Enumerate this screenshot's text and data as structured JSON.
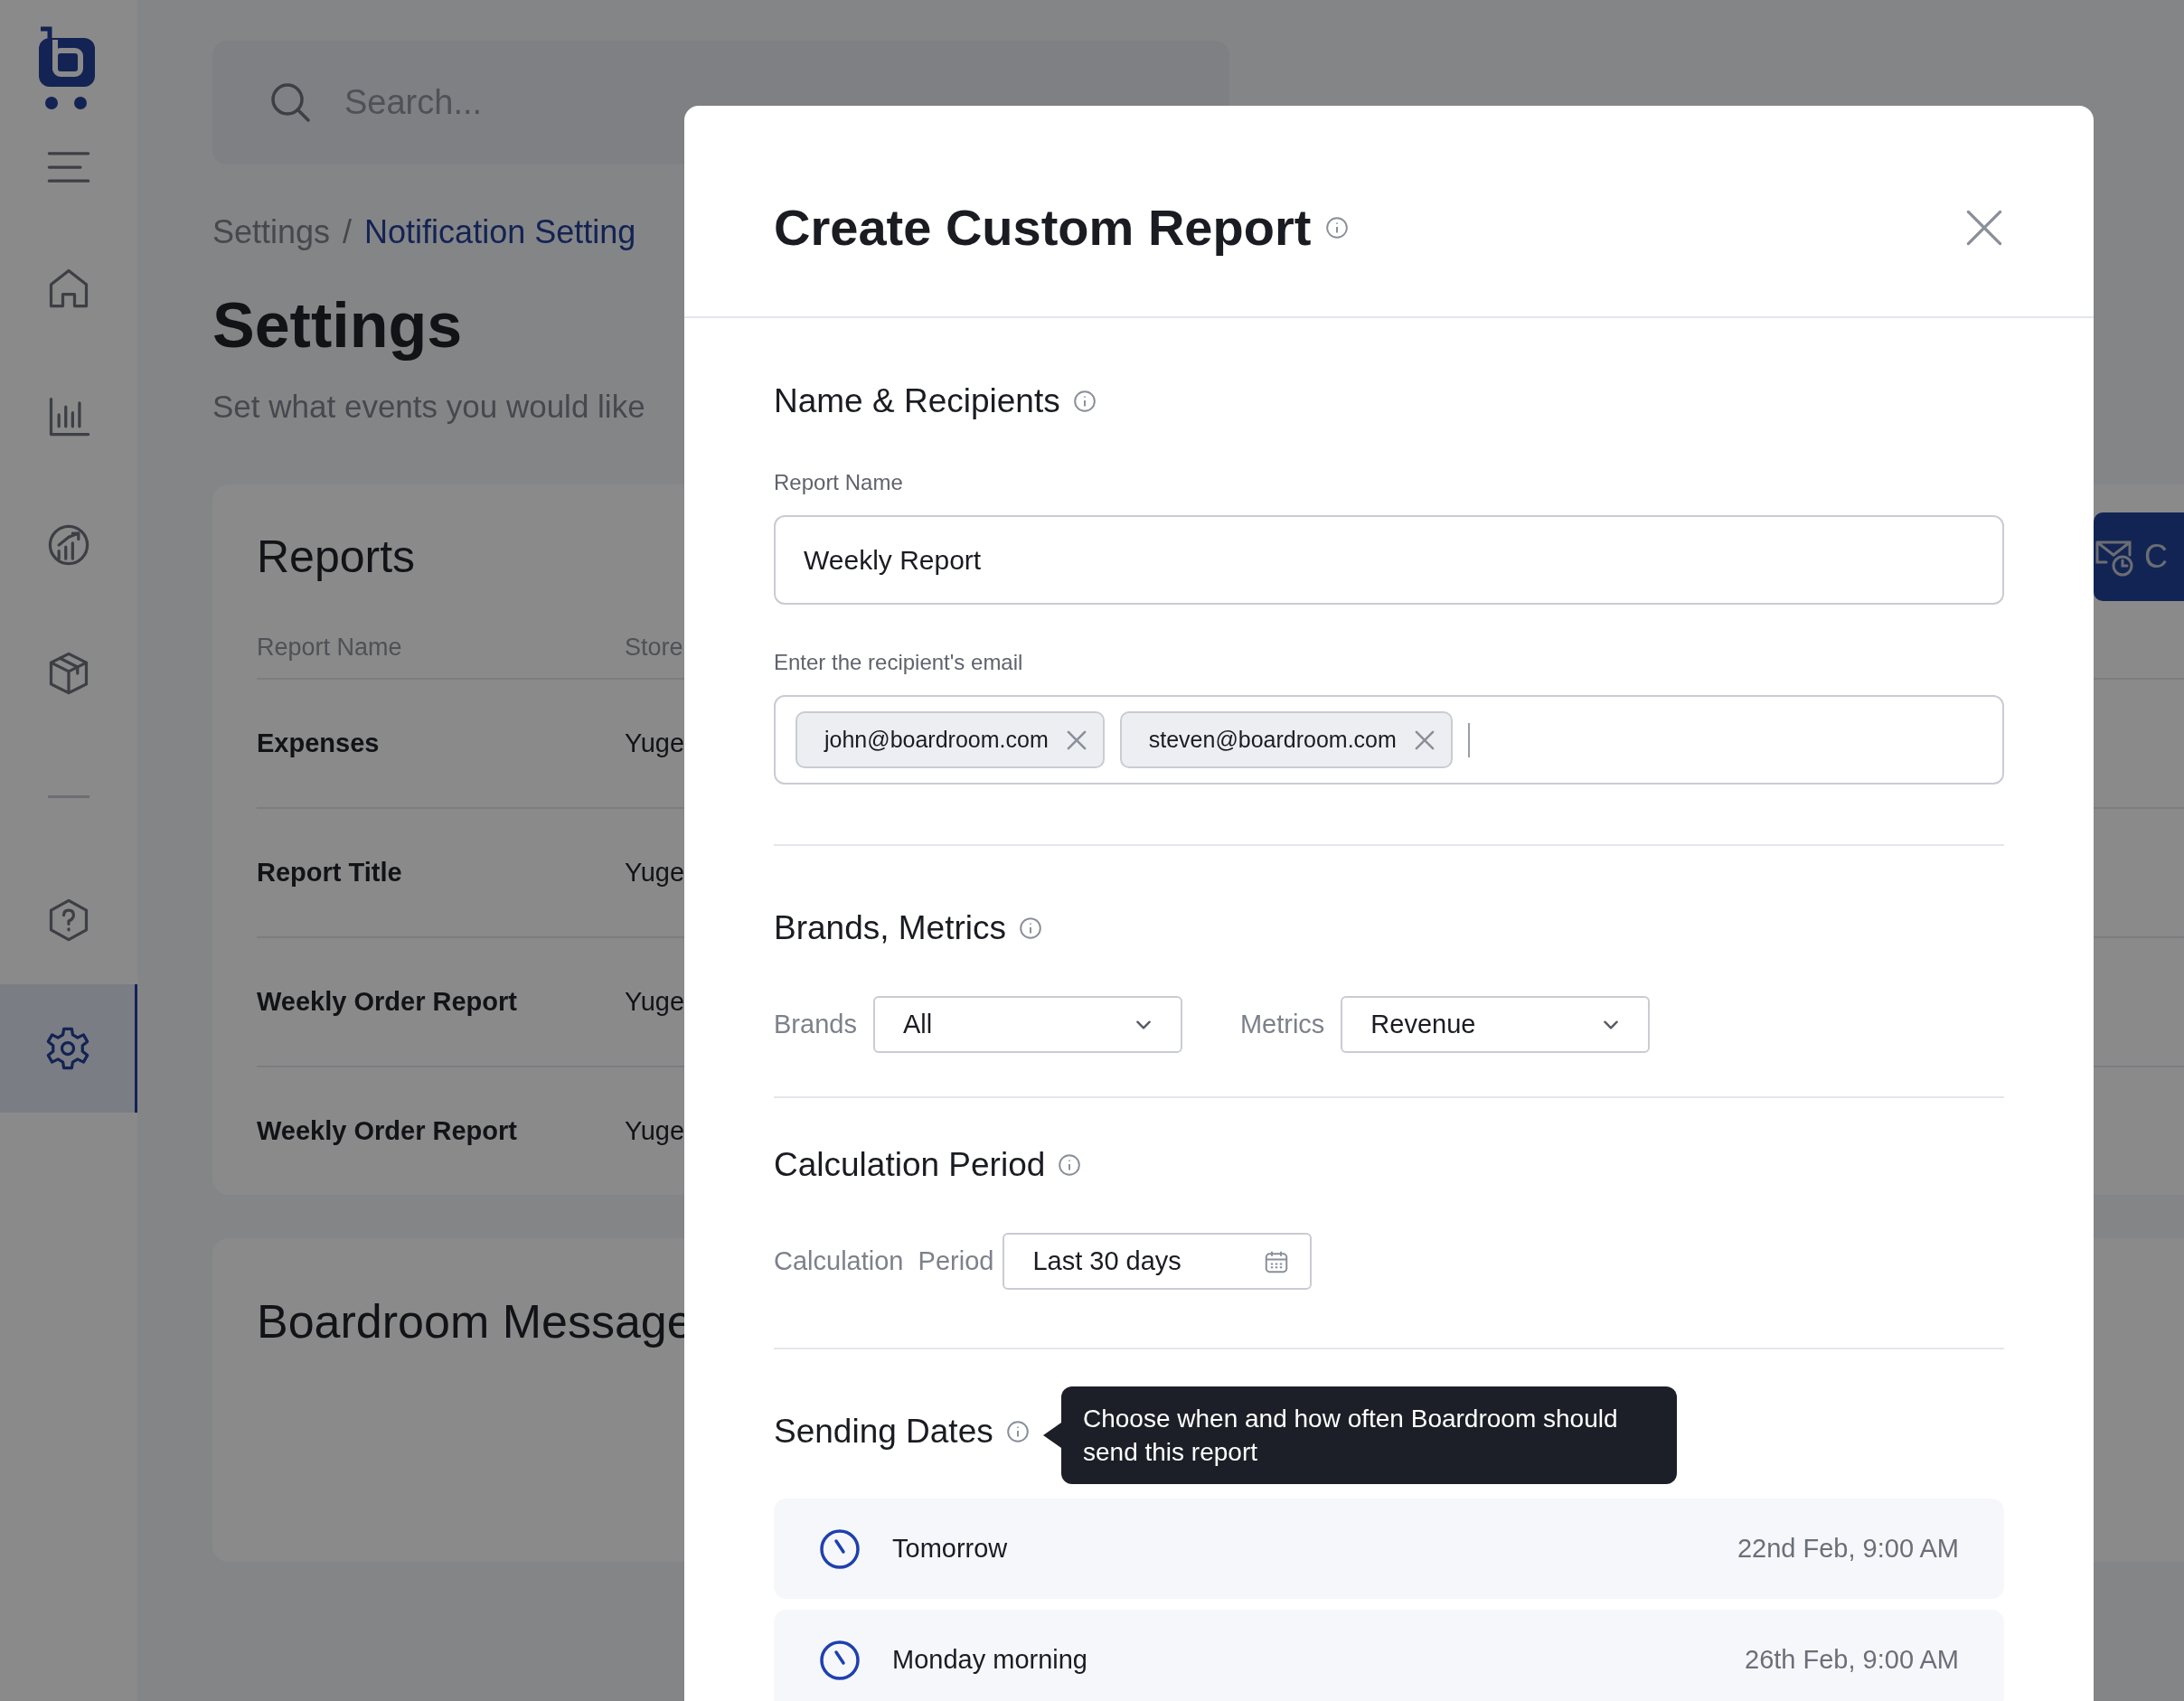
{
  "sidebar": {
    "items": [
      {
        "kind": "menu",
        "selected": false
      },
      {
        "kind": "home",
        "selected": false
      },
      {
        "kind": "chart",
        "selected": false
      },
      {
        "kind": "growth",
        "selected": false
      },
      {
        "kind": "box",
        "selected": false
      },
      {
        "kind": "divider"
      },
      {
        "kind": "help",
        "selected": false
      },
      {
        "kind": "settings",
        "selected": true
      }
    ]
  },
  "search": {
    "placeholder": "Search..."
  },
  "breadcrumb": {
    "separator": "/",
    "items": [
      {
        "label": "Settings",
        "current": false
      },
      {
        "label": "Notification Setting",
        "current": true
      }
    ]
  },
  "page": {
    "title": "Settings",
    "subtitle": "Set what events you would like"
  },
  "reports": {
    "title": "Reports",
    "action_label": "C",
    "columns": [
      "Report Name",
      "Store"
    ],
    "rows": [
      {
        "name": "Expenses",
        "store": "Yuge"
      },
      {
        "name": "Report Title",
        "store": "Yuge"
      },
      {
        "name": "Weekly Order Report",
        "store": "Yuge"
      },
      {
        "name": "Weekly Order Report",
        "store": "Yuge"
      }
    ]
  },
  "messages_card": {
    "title": "Boardroom Message"
  },
  "modal": {
    "title": "Create Custom Report",
    "name_recipients": {
      "title": "Name & Recipients",
      "report_name": {
        "label": "Report Name",
        "value": "Weekly Report"
      },
      "recipients": {
        "label": "Enter the recipient's email",
        "emails": [
          "john@boardroom.com",
          "steven@boardroom.com"
        ]
      }
    },
    "brands_metrics": {
      "title": "Brands, Metrics",
      "fields": [
        {
          "label": "Brands",
          "value": "All"
        },
        {
          "label": "Metrics",
          "value": "Revenue"
        }
      ]
    },
    "calculation": {
      "title": "Calculation Period",
      "label": "Calculation  Period",
      "value": "Last 30 days"
    },
    "sending": {
      "title": "Sending Dates",
      "tooltip": "Choose when and how often Boardroom should send this report",
      "schedules": [
        {
          "label": "Tomorrow",
          "date": "22nd Feb, 9:00 AM"
        },
        {
          "label": "Monday morning",
          "date": "26th Feb, 9:00 AM"
        }
      ]
    }
  }
}
